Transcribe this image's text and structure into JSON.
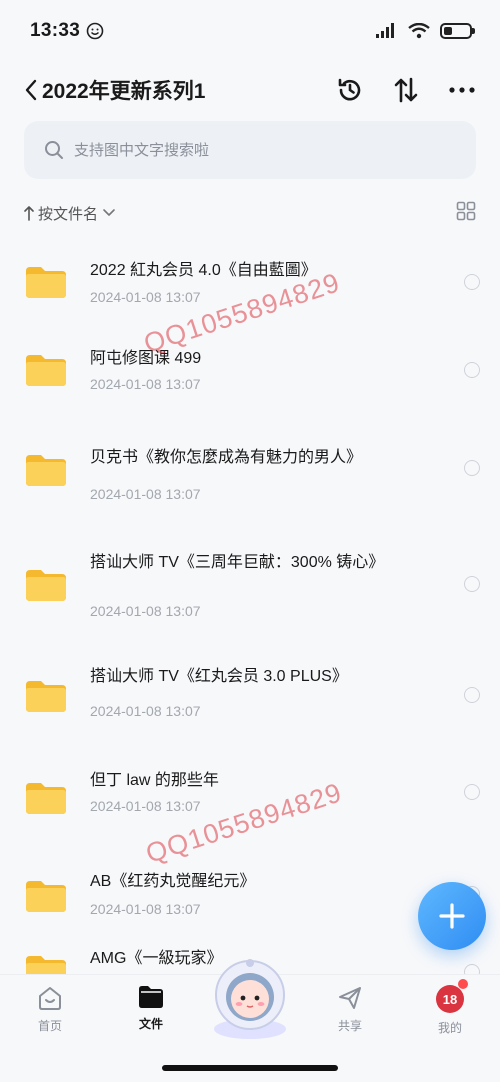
{
  "status_bar": {
    "time": "13:33"
  },
  "nav": {
    "back_glyph": "<",
    "title": "2022年更新系列1"
  },
  "search": {
    "placeholder": "支持图中文字搜索啦"
  },
  "sort": {
    "label": "按文件名"
  },
  "files": [
    {
      "name": "2022 紅丸会员 4.0《自由藍圖》",
      "date": "2024-01-08 13:07"
    },
    {
      "name": "阿屯修图课 499",
      "date": "2024-01-08 13:07"
    },
    {
      "name": "贝克书《教你怎麼成為有魅力的男人》",
      "date": "2024-01-08 13:07"
    },
    {
      "name": "搭讪大师 TV《三周年巨献：300% 铸心》",
      "date": "2024-01-08 13:07"
    },
    {
      "name": "搭讪大师 TV《红丸会员 3.0 PLUS》",
      "date": "2024-01-08 13:07"
    },
    {
      "name": "但丁 law 的那些年",
      "date": "2024-01-08 13:07"
    },
    {
      "name": "AB《红药丸觉醒纪元》",
      "date": "2024-01-08 13:07"
    },
    {
      "name": "AMG《一級玩家》",
      "date": ""
    }
  ],
  "watermarks": [
    "QQ1055894829",
    "QQ1055894829"
  ],
  "tabs": [
    {
      "label": "首页",
      "icon": "home-icon"
    },
    {
      "label": "文件",
      "icon": "folder-icon"
    },
    {
      "label": "共享",
      "icon": "send-icon"
    },
    {
      "label": "我的",
      "icon": "avatar-icon"
    }
  ],
  "profile_badge": "18",
  "colors": {
    "accent": "#2f8df2",
    "folder": "#f9c740",
    "muted": "#a3a7ae"
  }
}
